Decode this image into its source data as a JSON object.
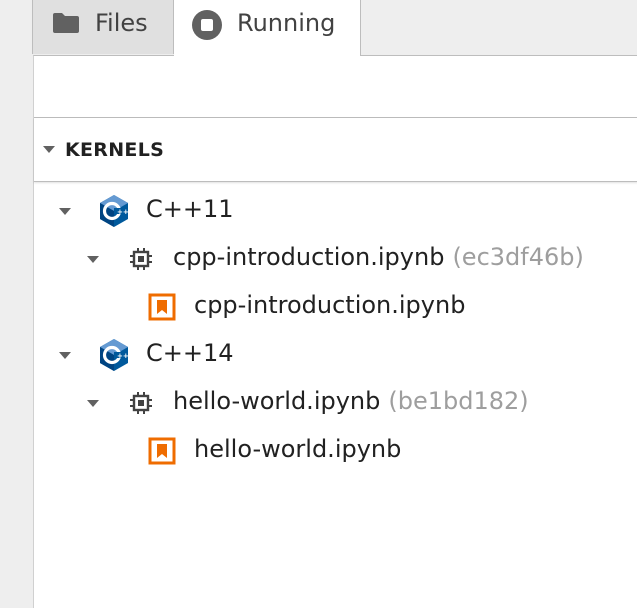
{
  "tabs": [
    {
      "label": "Files",
      "icon": "folder-icon",
      "active": false
    },
    {
      "label": "Running",
      "icon": "stop-circle-icon",
      "active": true
    }
  ],
  "section": {
    "title": "KERNELS",
    "expanded": true
  },
  "kernels": [
    {
      "name": "C++11",
      "icon": "cpp-logo-icon",
      "session": {
        "name": "cpp-introduction.ipynb",
        "kernel_id": "(ec3df46b)",
        "document": "cpp-introduction.ipynb"
      }
    },
    {
      "name": "C++14",
      "icon": "cpp-logo-icon",
      "session": {
        "name": "hello-world.ipynb",
        "kernel_id": "(be1bd182)",
        "document": "hello-world.ipynb"
      }
    }
  ],
  "colors": {
    "cpp_blue": "#00599c",
    "cpp_light": "#659ad2",
    "notebook_orange": "#ef6c00",
    "muted_text": "#9e9e9e"
  }
}
